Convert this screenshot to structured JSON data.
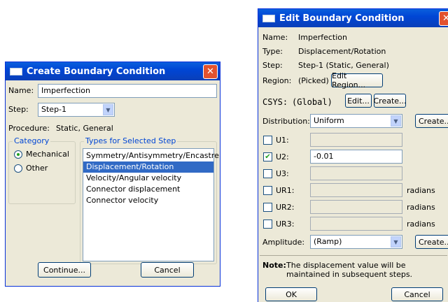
{
  "create_dialog": {
    "title": "Create Boundary Condition",
    "name_label": "Name:",
    "name_value": "Imperfection",
    "step_label": "Step:",
    "step_value": "Step-1",
    "procedure_label": "Procedure:",
    "procedure_value": "Static, General",
    "category": {
      "label": "Category",
      "options": [
        {
          "label": "Mechanical",
          "selected": true
        },
        {
          "label": "Other",
          "selected": false
        }
      ]
    },
    "types": {
      "label": "Types for Selected Step",
      "items": [
        {
          "label": "Symmetry/Antisymmetry/Encastre",
          "selected": false
        },
        {
          "label": "Displacement/Rotation",
          "selected": true
        },
        {
          "label": "Velocity/Angular velocity",
          "selected": false
        },
        {
          "label": "Connector displacement",
          "selected": false
        },
        {
          "label": "Connector velocity",
          "selected": false
        }
      ]
    },
    "continue_label": "Continue...",
    "cancel_label": "Cancel"
  },
  "edit_dialog": {
    "title": "Edit Boundary Condition",
    "name_label": "Name:",
    "name_value": "Imperfection",
    "type_label": "Type:",
    "type_value": "Displacement/Rotation",
    "step_label": "Step:",
    "step_value": "Step-1 (Static, General)",
    "region_label": "Region:",
    "region_value": "(Picked)",
    "edit_region_label": "Edit Region...",
    "csys_label": "CSYS:",
    "csys_value": "(Global)",
    "csys_edit_label": "Edit...",
    "csys_create_label": "Create...",
    "distribution_label": "Distribution:",
    "distribution_value": "Uniform",
    "distribution_create_label": "Create...",
    "dofs": [
      {
        "label": "U1:",
        "checked": false,
        "value": "",
        "unit": ""
      },
      {
        "label": "U2:",
        "checked": true,
        "value": "-0.01",
        "unit": ""
      },
      {
        "label": "U3:",
        "checked": false,
        "value": "",
        "unit": ""
      },
      {
        "label": "UR1:",
        "checked": false,
        "value": "",
        "unit": "radians"
      },
      {
        "label": "UR2:",
        "checked": false,
        "value": "",
        "unit": "radians"
      },
      {
        "label": "UR3:",
        "checked": false,
        "value": "",
        "unit": "radians"
      }
    ],
    "amplitude_label": "Amplitude:",
    "amplitude_value": "(Ramp)",
    "amplitude_create_label": "Create...",
    "note_label": "Note:",
    "note_line1": "The displacement value will be",
    "note_line2": "maintained in subsequent steps.",
    "ok_label": "OK",
    "cancel_label": "Cancel"
  },
  "colors": {
    "titlebar": "#0046d5",
    "dialog_bg": "#ece9d8",
    "selection": "#316ac5",
    "close_button": "#e2522e",
    "group_label": "#0046d5"
  }
}
